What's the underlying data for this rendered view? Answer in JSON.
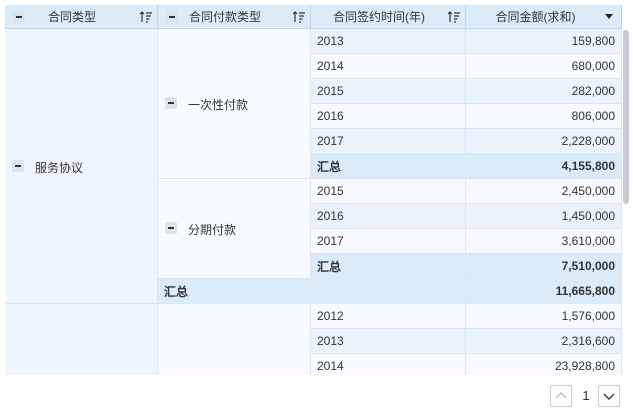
{
  "headers": {
    "contract_type": "合同类型",
    "payment_type": "合同付款类型",
    "sign_year": "合同签约时间(年)",
    "amount": "合同金额(求和)"
  },
  "groups": {
    "service": {
      "label": "服务协议",
      "total_label": "汇总",
      "total": "11,665,800"
    },
    "one_time": {
      "label": "一次性付款"
    },
    "installment": {
      "label": "分期付款"
    }
  },
  "rows": [
    {
      "year": "2013",
      "amount": "159,800"
    },
    {
      "year": "2014",
      "amount": "680,000"
    },
    {
      "year": "2015",
      "amount": "282,000"
    },
    {
      "year": "2016",
      "amount": "806,000"
    },
    {
      "year": "2017",
      "amount": "2,228,000"
    },
    {
      "year": "汇总",
      "amount": "4,155,800"
    },
    {
      "year": "2015",
      "amount": "2,450,000"
    },
    {
      "year": "2016",
      "amount": "1,450,000"
    },
    {
      "year": "2017",
      "amount": "3,610,000"
    },
    {
      "year": "汇总",
      "amount": "7,510,000"
    },
    {
      "year": "2012",
      "amount": "1,576,000"
    },
    {
      "year": "2013",
      "amount": "2,316,600"
    },
    {
      "year": "2014",
      "amount": "23,928,800"
    }
  ],
  "pagination": {
    "current_page": "1"
  }
}
